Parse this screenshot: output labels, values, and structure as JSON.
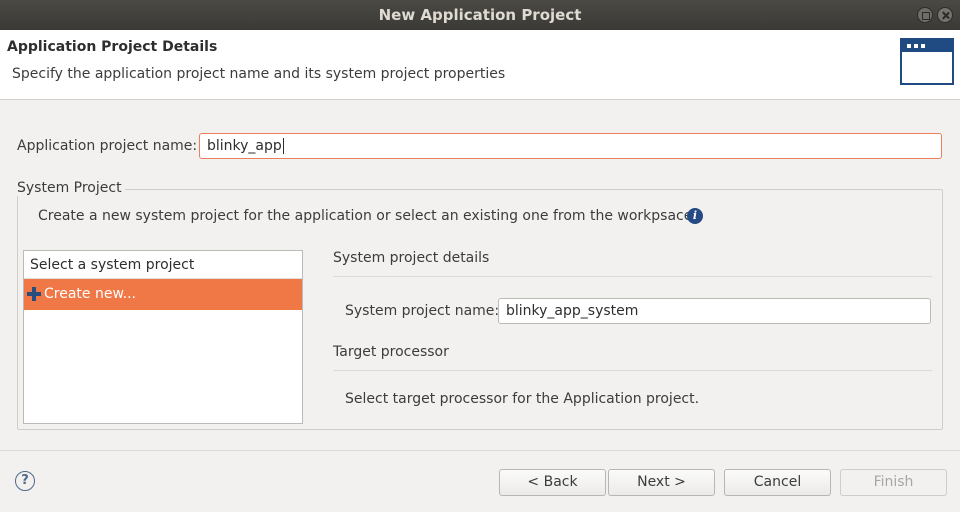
{
  "window": {
    "title": "New Application Project"
  },
  "header": {
    "title": "Application Project Details",
    "description": "Specify the application project name and its system project properties",
    "icon": "window-icon"
  },
  "app_name": {
    "label": "Application project name:",
    "value": "blinky_app"
  },
  "system_project": {
    "legend": "System Project",
    "description": "Create a new system project for the application or select an existing one from the workpsace",
    "info_icon": "i",
    "list": {
      "header": "Select a system project",
      "items": [
        {
          "label": "Create new...",
          "icon": "plus-icon",
          "selected": true
        }
      ]
    },
    "details": {
      "title": "System project details",
      "name_label": "System project name:",
      "name_value": "blinky_app_system",
      "target_title": "Target processor",
      "target_desc": "Select target processor for the Application project."
    }
  },
  "footer": {
    "help_icon": "?",
    "back": "< Back",
    "next": "Next >",
    "cancel": "Cancel",
    "finish": "Finish"
  },
  "colors": {
    "accent": "#f07746",
    "title_bar": "#3b3a36",
    "icon_blue": "#1f4b82"
  }
}
